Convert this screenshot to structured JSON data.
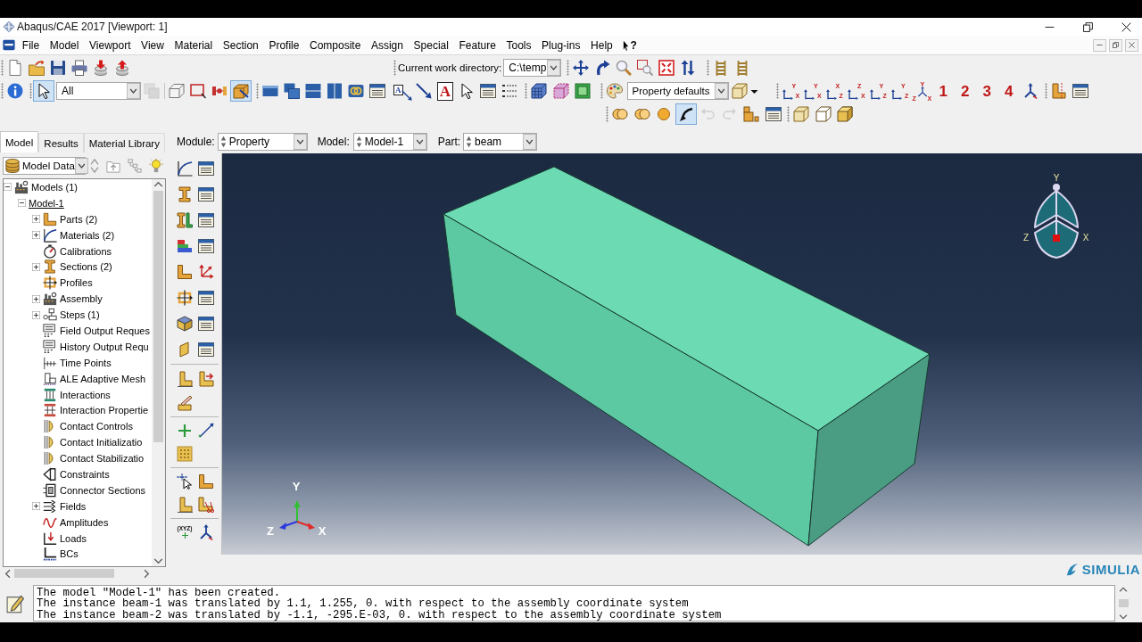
{
  "window": {
    "title": "Abaqus/CAE 2017 [Viewport: 1]"
  },
  "menu_bar": {
    "items": [
      "File",
      "Model",
      "Viewport",
      "View",
      "Material",
      "Section",
      "Profile",
      "Composite",
      "Assign",
      "Special",
      "Feature",
      "Tools",
      "Plug-ins",
      "Help"
    ],
    "context_help": "?"
  },
  "work_directory": {
    "label": "Current work directory:",
    "value": "C:\\temp"
  },
  "selection_toolbar": {
    "filter": "All",
    "tools": [
      {
        "pressed": true,
        "disabled": false
      },
      {
        "pressed": false,
        "disabled": true
      },
      {
        "pressed": false,
        "disabled": false
      },
      {
        "pressed": false,
        "disabled": false
      },
      {
        "pressed": false,
        "disabled": false
      },
      {
        "pressed": true,
        "disabled": false
      }
    ]
  },
  "text_tools": [
    {
      "glyph": "A"
    },
    {
      "glyph": "A"
    }
  ],
  "display_toolbar": {
    "color_scheme": "Property defaults"
  },
  "view_toolbar": {
    "buttons": [
      {
        "kind": "axes",
        "axes": [
          "Y",
          "X"
        ]
      },
      {
        "kind": "axes",
        "axes": [
          "Y",
          "X"
        ]
      },
      {
        "kind": "axes",
        "axes": [
          "X",
          "Z"
        ]
      },
      {
        "kind": "axes",
        "axes": [
          "Z",
          "X"
        ]
      },
      {
        "kind": "axes",
        "axes": [
          "Y",
          "Z"
        ]
      },
      {
        "kind": "axes",
        "axes": [
          "Y",
          "Z"
        ]
      },
      {
        "kind": "triad",
        "axes": [
          "Y",
          "Z",
          "X"
        ]
      },
      {
        "kind": "number",
        "label": "1"
      },
      {
        "kind": "number",
        "label": "2"
      },
      {
        "kind": "number",
        "label": "3"
      },
      {
        "kind": "number",
        "label": "4"
      }
    ]
  },
  "part_toolbar": {
    "tools": [
      {
        "pressed": false,
        "disabled": false
      },
      {
        "pressed": false,
        "disabled": false
      },
      {
        "pressed": false,
        "disabled": false
      },
      {
        "pressed": true,
        "disabled": false
      },
      {
        "pressed": false,
        "disabled": true
      },
      {
        "pressed": false,
        "disabled": true
      },
      {
        "pressed": false,
        "disabled": false
      },
      {
        "pressed": false,
        "disabled": false
      }
    ]
  },
  "model_tree_tabs": [
    {
      "label": "Model",
      "selected": true
    },
    {
      "label": "Results",
      "selected": false
    },
    {
      "label": "Material Library",
      "selected": false
    }
  ],
  "context_bar": {
    "module_label": "Module:",
    "module": "Property",
    "model_label": "Model:",
    "model": "Model-1",
    "part_label": "Part:",
    "part": "beam"
  },
  "model_tree": {
    "source": "Model Data",
    "items": [
      {
        "label": "Models (1)",
        "expanded": true,
        "children": [
          {
            "label": "Model-1",
            "expanded": true,
            "current": true,
            "children": [
              {
                "label": "Parts (2)",
                "expanded": false
              },
              {
                "label": "Materials (2)",
                "expanded": false
              },
              {
                "label": "Calibrations"
              },
              {
                "label": "Sections (2)",
                "expanded": false
              },
              {
                "label": "Profiles"
              },
              {
                "label": "Assembly",
                "expanded": false
              },
              {
                "label": "Steps (1)",
                "expanded": false
              },
              {
                "label": "Field Output Reques"
              },
              {
                "label": "History Output Requ"
              },
              {
                "label": "Time Points"
              },
              {
                "label": "ALE Adaptive Mesh"
              },
              {
                "label": "Interactions"
              },
              {
                "label": "Interaction Propertie"
              },
              {
                "label": "Contact Controls"
              },
              {
                "label": "Contact Initializatio"
              },
              {
                "label": "Contact Stabilizatio"
              },
              {
                "label": "Constraints"
              },
              {
                "label": "Connector Sections"
              },
              {
                "label": "Fields",
                "expanded": false
              },
              {
                "label": "Amplitudes"
              },
              {
                "label": "Loads"
              },
              {
                "label": "BCs"
              }
            ]
          }
        ]
      }
    ]
  },
  "toolbox": {
    "point_tool_label": "(XYZ)"
  },
  "viewport": {
    "triad": {
      "x": "X",
      "y": "Y",
      "z": "Z"
    },
    "view_cube": {
      "x": "X",
      "y": "Y",
      "z": "Z"
    }
  },
  "brand": "SIMULIA",
  "message_area": {
    "lines": [
      "The model \"Model-1\" has been created.",
      "The instance beam-1 was translated by 1.1, 1.255, 0. with respect to the assembly coordinate system",
      "The instance beam-2 was translated by -1.1, -295.E-03, 0. with respect to the assembly coordinate system"
    ]
  }
}
